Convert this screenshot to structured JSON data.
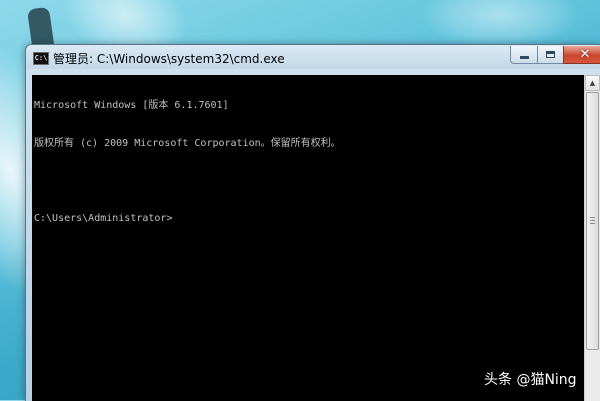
{
  "window": {
    "icon_label": "C:\\",
    "title": "管理员: C:\\Windows\\system32\\cmd.exe",
    "controls": {
      "minimize_icon": "minimize-icon",
      "maximize_icon": "maximize-icon",
      "close_icon": "close-icon",
      "close_glyph": "✕"
    }
  },
  "console": {
    "lines": [
      "Microsoft Windows [版本 6.1.7601]",
      "版权所有 (c) 2009 Microsoft Corporation。保留所有权利。",
      "",
      "C:\\Users\\Administrator>"
    ],
    "text_color": "#c0c0c0",
    "background": "#000000"
  },
  "scrollbar": {
    "up_arrow": "▲"
  },
  "watermark": {
    "text": "头条 @猫Ning"
  }
}
